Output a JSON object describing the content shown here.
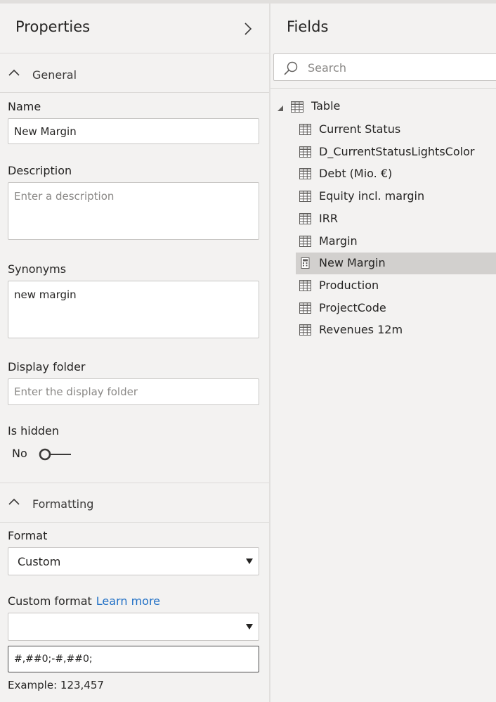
{
  "properties": {
    "title": "Properties",
    "general_section": "General",
    "name_label": "Name",
    "name_value": "New Margin",
    "description_label": "Description",
    "description_placeholder": "Enter a description",
    "synonyms_label": "Synonyms",
    "synonyms_value": "new margin",
    "display_folder_label": "Display folder",
    "display_folder_placeholder": "Enter the display folder",
    "is_hidden_label": "Is hidden",
    "is_hidden_value": "No",
    "formatting_section": "Formatting",
    "format_label": "Format",
    "format_value": "Custom",
    "custom_format_label": "Custom format",
    "learn_more": "Learn more",
    "custom_format_select_value": "",
    "custom_format_value": "#,##0;-#,##0;",
    "example": "Example: 123,457"
  },
  "fields": {
    "title": "Fields",
    "search_placeholder": "Search",
    "table_name": "Table",
    "items": [
      {
        "label": "Current Status",
        "icon": "column-icon"
      },
      {
        "label": "D_CurrentStatusLightsColor",
        "icon": "column-icon"
      },
      {
        "label": "Debt (Mio. €)",
        "icon": "column-icon"
      },
      {
        "label": "Equity incl. margin",
        "icon": "column-icon"
      },
      {
        "label": "IRR",
        "icon": "column-icon"
      },
      {
        "label": "Margin",
        "icon": "column-icon"
      },
      {
        "label": "New Margin",
        "icon": "calculator-icon",
        "selected": true
      },
      {
        "label": "Production",
        "icon": "column-icon"
      },
      {
        "label": "ProjectCode",
        "icon": "column-icon"
      },
      {
        "label": "Revenues 12m",
        "icon": "column-icon"
      }
    ]
  },
  "colors": {
    "background": "#f3f2f1",
    "selected_row": "#d2d0ce",
    "link": "#1f6fc5"
  }
}
